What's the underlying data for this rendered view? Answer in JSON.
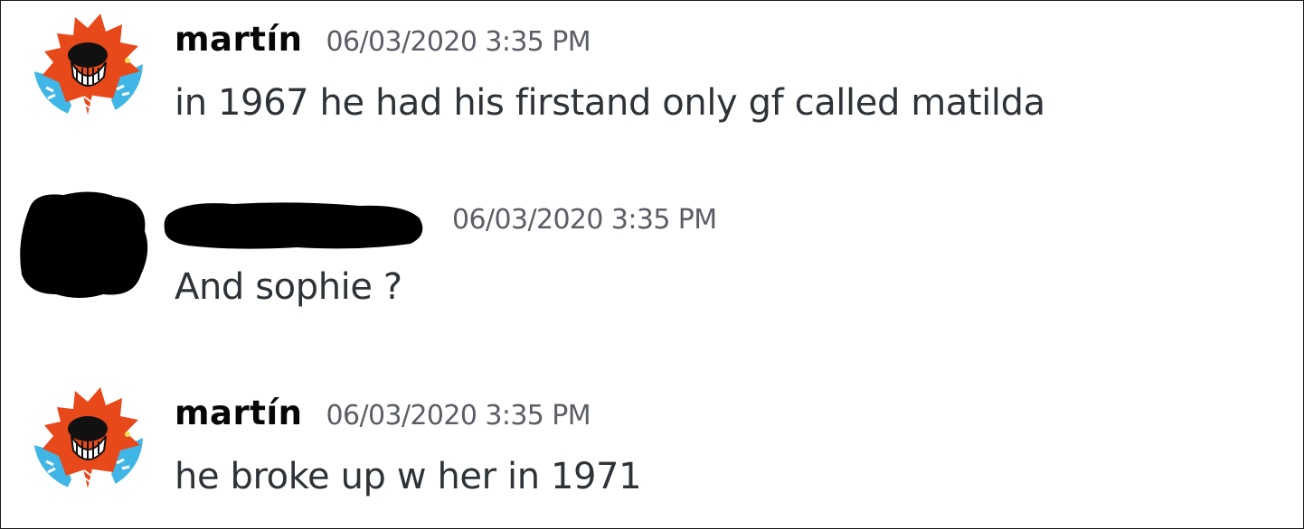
{
  "messages": [
    {
      "author": "martín",
      "timestamp": "06/03/2020 3:35 PM",
      "text": "in 1967 he had his firstand only gf called matilda",
      "avatar_icon": "cartoon-character-avatar-icon"
    },
    {
      "author": "",
      "author_redacted": true,
      "timestamp": "06/03/2020 3:35 PM",
      "text": "And sophie ?",
      "avatar_icon": "redacted-avatar"
    },
    {
      "author": "martín",
      "timestamp": "06/03/2020 3:35 PM",
      "text": "he broke up w her in 1971",
      "avatar_icon": "cartoon-character-avatar-icon"
    }
  ],
  "colors": {
    "username": "#060607",
    "timestamp": "#5c5e66",
    "message_text": "#2e3338",
    "avatar_orange": "#e8491b",
    "avatar_blue": "#3fb6e6",
    "redaction": "#000000"
  }
}
